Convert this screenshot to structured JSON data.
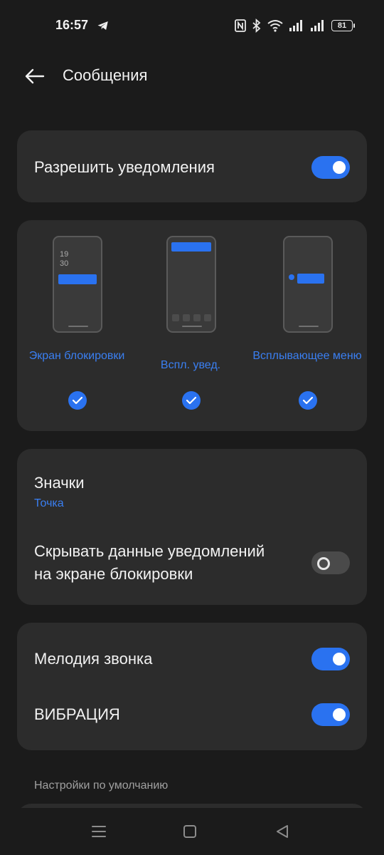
{
  "status_bar": {
    "time": "16:57",
    "battery": "81",
    "icons": [
      "telegram-icon",
      "nfc-icon",
      "bluetooth-icon",
      "wifi-icon",
      "signal-icon",
      "signal-icon",
      "battery-icon"
    ]
  },
  "header": {
    "title": "Сообщения",
    "back_icon": "arrow-left-icon"
  },
  "allow_notifications": {
    "label": "Разрешить уведомления",
    "enabled": true
  },
  "notification_styles": [
    {
      "label": "Экран блокировки",
      "checked": true,
      "preview_clock": [
        "19",
        "30"
      ]
    },
    {
      "label": "Вспл. увед.",
      "checked": true
    },
    {
      "label": "Всплывающее меню",
      "checked": true
    }
  ],
  "badges": {
    "label": "Значки",
    "value": "Точка"
  },
  "hide_content": {
    "label_line1": "Скрывать данные уведомлений",
    "label_line2": "на экране блокировки",
    "enabled": false
  },
  "ringtone": {
    "label": "Мелодия звонка",
    "enabled": true
  },
  "vibration": {
    "label": "ВИБРАЦИЯ",
    "enabled": true
  },
  "defaults_caption": "Настройки по умолчанию",
  "colors": {
    "accent": "#2a72f0",
    "accent_text": "#3a7ff2",
    "background": "#1b1b1b",
    "card": "#2c2c2c"
  },
  "nav_bar": {
    "icons": [
      "menu-icon",
      "home-square-icon",
      "back-triangle-icon"
    ]
  }
}
